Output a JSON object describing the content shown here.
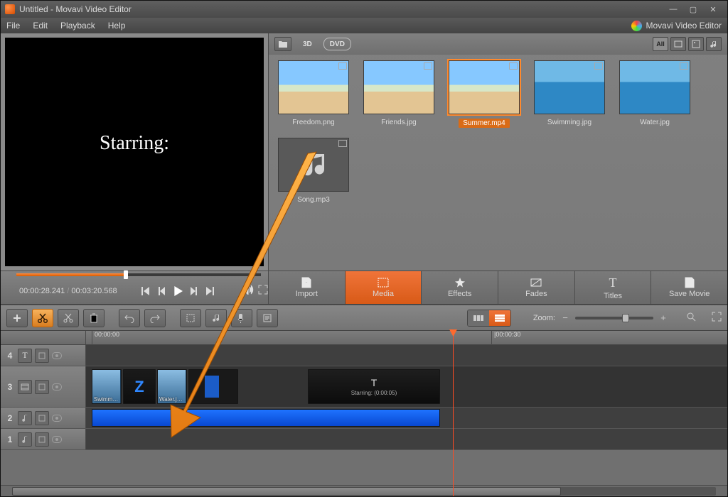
{
  "window": {
    "title": "Untitled - Movavi Video Editor"
  },
  "menu": {
    "file": "File",
    "edit": "Edit",
    "playback": "Playback",
    "help": "Help"
  },
  "brand": "Movavi Video Editor",
  "preview": {
    "overlay_text": "Starring:",
    "time_current": "00:00:28.241",
    "time_total": "00:03:20.568"
  },
  "media": {
    "btn_3d": "3D",
    "btn_dvd": "DVD",
    "view_all": "All",
    "items": [
      {
        "label": "Freedom.png"
      },
      {
        "label": "Friends.jpg"
      },
      {
        "label": "Summer.mp4",
        "sel": true
      },
      {
        "label": "Swimming.jpg"
      },
      {
        "label": "Water.jpg"
      },
      {
        "label": "Song.mp3",
        "audio": true
      }
    ]
  },
  "tabs": {
    "import": "Import",
    "media": "Media",
    "effects": "Effects",
    "fades": "Fades",
    "titles": "Titles",
    "save": "Save Movie"
  },
  "zoom_label": "Zoom:",
  "ruler": {
    "t0": "00:00:00",
    "t1": "|00:00:30"
  },
  "timeline": {
    "tracks": [
      {
        "n": "4",
        "type": "title"
      },
      {
        "n": "3",
        "type": "video"
      },
      {
        "n": "2",
        "type": "audio"
      },
      {
        "n": "1",
        "type": "audio"
      }
    ],
    "title_clip": {
      "text": "T",
      "sub": "Starring: (0:00:05)"
    },
    "v1_label": "Swimm…",
    "v2_label": "Water.j…"
  }
}
